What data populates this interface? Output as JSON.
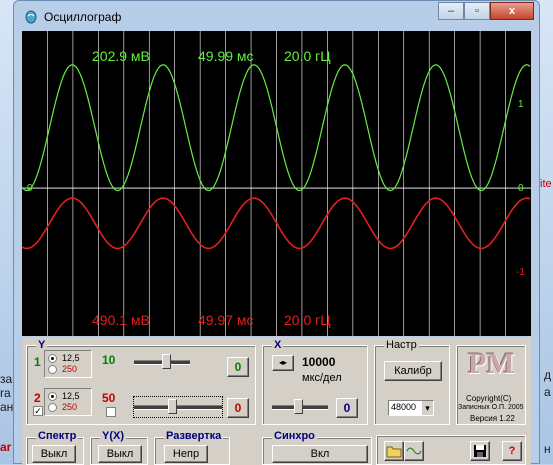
{
  "window": {
    "title": "Осциллограф",
    "min": "–",
    "max": "▫",
    "close": "x"
  },
  "colors": {
    "ch1": "#66ee44",
    "ch2": "#e02020",
    "grid": "#ffffff",
    "bg": "#000000"
  },
  "background": {
    "left_text": [
      "за",
      "ra",
      "ан",
      "ar"
    ],
    "right_text": [
      "д",
      "а",
      "ite",
      "н"
    ]
  },
  "scope": {
    "ch1_readout": {
      "voltage": "202.9 мВ",
      "period": "49.99 мс",
      "frequency": "20.0 гЦ"
    },
    "ch2_readout": {
      "voltage": "490.1 мВ",
      "period": "49.97 мс",
      "frequency": "20.0 гЦ"
    },
    "right_scale": {
      "top": "1",
      "mid": "0",
      "bottom": "-1"
    },
    "left_zero": "0",
    "ch1_wave": {
      "cycles": 5.6,
      "amplitude_divs": 0.75,
      "offset": 0.72
    },
    "ch2_wave": {
      "cycles": 5.6,
      "amplitude_divs": 0.3,
      "offset": -0.42
    }
  },
  "controls": {
    "y": {
      "label": "Y",
      "ch1_num": "1",
      "ch1_opt1": "12,5",
      "ch1_opt2": "250",
      "ch1_value": "10",
      "ch1_btn": "0",
      "ch2_num": "2",
      "ch2_opt1": "12,5",
      "ch2_opt2": "250",
      "ch2_value": "50",
      "ch2_btn": "0",
      "ch2_checked": "✓",
      "ch1_selected": "12,5",
      "ch2_selected": "12,5"
    },
    "x": {
      "label": "X",
      "value": "10000",
      "unit": "мкс/дел",
      "btn": "0"
    },
    "settings": {
      "label": "Настр",
      "calib": "Калибр",
      "rate": "48000",
      "rate_arrow": "▾"
    },
    "logo": {
      "text": "PM",
      "copyright": "Copyright(C)",
      "author": "Записных О.П. 2005",
      "version": "Версия 1.22"
    },
    "spectr": {
      "label": "Спектр",
      "btn": "Выкл"
    },
    "yx": {
      "label": "Y(X)",
      "btn": "Выкл"
    },
    "sweep": {
      "label": "Развертка",
      "btn": "Непр"
    },
    "sync": {
      "label": "Синхро",
      "btn": "Вкл"
    },
    "help": "?"
  }
}
